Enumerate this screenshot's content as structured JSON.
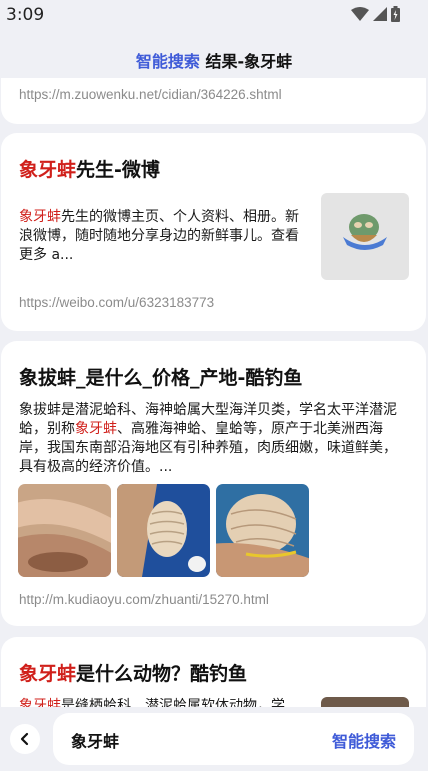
{
  "status": {
    "time": "3:09"
  },
  "header": {
    "brand": "智能搜索",
    "title": " 结果-象牙蚌"
  },
  "results": [
    {
      "url": "https://m.zuowenku.net/cidian/364226.shtml"
    },
    {
      "title_hl": "象牙蚌",
      "title_rest": "先生-微博",
      "desc_hl": "象牙蚌",
      "desc_rest": "先生的微博主页、个人资料、相册。新浪微博，随时随地分享身边的新鲜事儿。查看更多 a...",
      "url": "https://weibo.com/u/6323183773"
    },
    {
      "title": "象拔蚌_是什么_价格_产地-酷钓鱼",
      "desc_p1": "象拔蚌是潜泥蛤科、海神蛤属大型海洋贝类，学名太平洋潜泥蛤，别称",
      "desc_hl": "象牙蚌",
      "desc_p2": "、高雅海神蛤、皇蛤等，原产于北美洲西海岸，我国东南部沿海地区有引种养殖，肉质细嫩，味道鲜美，具有极高的经济价值。...",
      "url": "http://m.kudiaoyu.com/zhuanti/15270.html"
    },
    {
      "title_hl": "象牙蚌",
      "title_rest": "是什么动物？酷钓鱼",
      "desc_hl": "象牙蚌",
      "desc_rest": "是缝栖蛤科、潜泥蛤属软体动物，学"
    }
  ],
  "search": {
    "query": "象牙蚌",
    "button": "智能搜索"
  },
  "icons": {
    "back": "chevron-left-icon",
    "wifi": "wifi-icon",
    "signal": "signal-icon",
    "battery": "battery-icon"
  },
  "colors": {
    "brand": "#3f5bd8",
    "highlight": "#d0201b",
    "background": "#eff0f5"
  }
}
